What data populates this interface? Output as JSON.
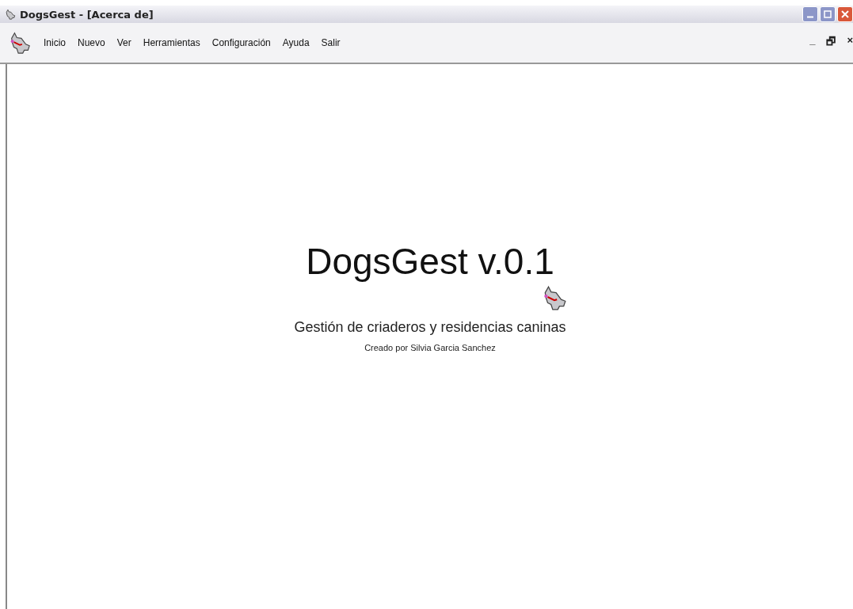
{
  "window": {
    "title": "DogsGest - [Acerca de]"
  },
  "menu": [
    "Inicio",
    "Nuevo",
    "Ver",
    "Herramientas",
    "Configuración",
    "Ayuda",
    "Salir"
  ],
  "child_controls": [
    "_",
    "🗗",
    "×"
  ],
  "about": {
    "title": "DogsGest v.0.1",
    "subtitle": "Gestión de criaderos y residencias caninas",
    "credit": "Creado por Silvia Garcia Sanchez"
  }
}
